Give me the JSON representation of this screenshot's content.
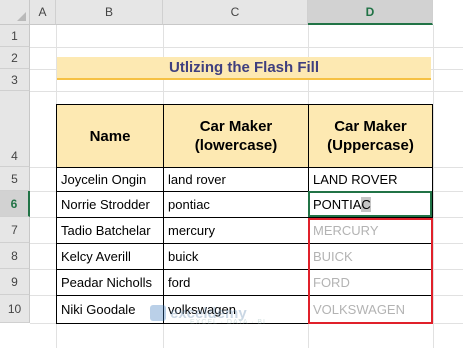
{
  "columns": [
    "A",
    "B",
    "C",
    "D"
  ],
  "rows": [
    "1",
    "2",
    "3",
    "4",
    "5",
    "6",
    "7",
    "8",
    "9",
    "10"
  ],
  "title": "Utlizing the Flash Fill",
  "table": {
    "headers": [
      "Name",
      "Car Maker\n(lowercase)",
      "Car Maker\n(Uppercase)"
    ],
    "rows": [
      {
        "name": "Joycelin Ongin",
        "lower": "land rover",
        "upper": "LAND ROVER"
      },
      {
        "name": "Norrie Strodder",
        "lower": "pontiac",
        "upper": "PONTIAC"
      },
      {
        "name": "Tadio Batchelar",
        "lower": "mercury",
        "upper": "MERCURY"
      },
      {
        "name": "Kelcy Averill",
        "lower": "buick",
        "upper": "BUICK"
      },
      {
        "name": "Peadar Nicholls",
        "lower": "ford",
        "upper": "FORD"
      },
      {
        "name": "Niki Goodale",
        "lower": "volkswagen",
        "upper": "VOLKSWAGEN"
      }
    ]
  },
  "active_cell_typed": "PONTIA",
  "active_cell_suggested": "C",
  "watermark": {
    "brand": "exceldemy",
    "tagline": "EXCEL · DATA · BI"
  }
}
